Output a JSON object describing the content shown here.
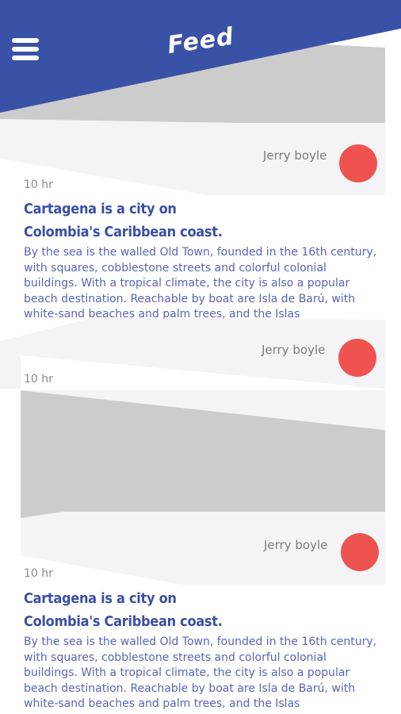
{
  "header": {
    "title": "Feed",
    "menu_icon": "hamburger-menu-icon",
    "color": "#3a52a6"
  },
  "posts": [
    {
      "author": "Jerry boyle",
      "time": "10 hr",
      "title_line1": "Cartagena is a city on",
      "title_line2": "Colombia's Caribbean coast.",
      "body": "By the sea is the walled Old Town, founded in the 16th century, with squares, cobblestone streets and colorful colonial buildings. With a tropical climate, the city is also a popular beach destination. Reachable by boat are Isla de Barú, with white-sand beaches and palm trees, and the Islas"
    },
    {
      "author": "Jerry boyle",
      "time": "10 hr"
    },
    {
      "author": "Jerry boyle",
      "time": "10 hr",
      "title_line1": "Cartagena is a city on",
      "title_line2": "Colombia's Caribbean coast.",
      "body": "By the sea is the walled Old Town, founded in the 16th century, with squares, cobblestone streets and colorful colonial buildings. With a tropical climate, the city is also a popular beach destination. Reachable by boat are Isla de Barú, with white-sand beaches and palm trees, and the Islas"
    }
  ],
  "colors": {
    "avatar": "#ef5350",
    "headline": "#3a4fa6",
    "body": "#5765b8",
    "placeholder": "#cccccc",
    "card_bg": "#f4f4f6"
  }
}
